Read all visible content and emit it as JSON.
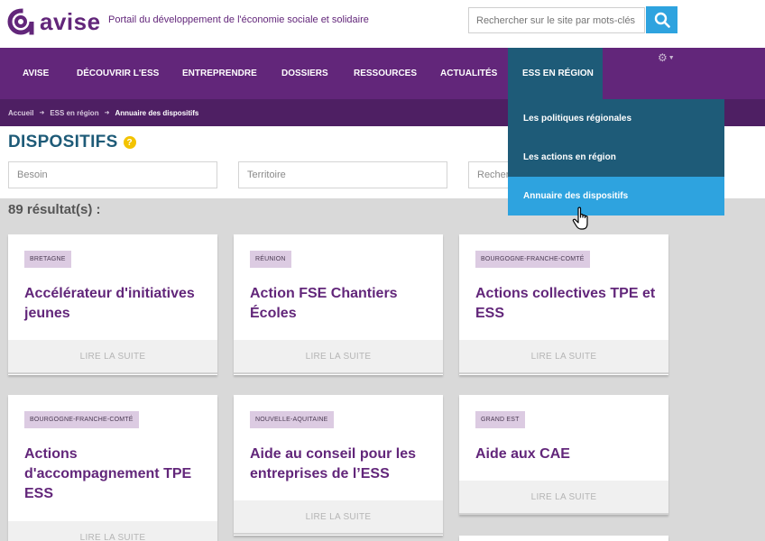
{
  "header": {
    "logo_text": "avise",
    "tagline": "Portail du développement de l'économie sociale et solidaire",
    "search": {
      "placeholder": "Rechercher sur le site par mots-clés"
    }
  },
  "nav": {
    "items": [
      {
        "label": "AVISE"
      },
      {
        "label": "DÉCOUVRIR L'ESS"
      },
      {
        "label": "ENTREPRENDRE"
      },
      {
        "label": "DOSSIERS"
      },
      {
        "label": "RESSOURCES"
      },
      {
        "label": "ACTUALITÉS"
      },
      {
        "label": "ESS EN RÉGION"
      }
    ],
    "active_index": 6
  },
  "dropdown": {
    "items": [
      {
        "label": "Les politiques régionales"
      },
      {
        "label": "Les actions en région"
      },
      {
        "label": "Annuaire des dispositifs"
      }
    ],
    "hovered_index": 2
  },
  "breadcrumb": [
    "Accueil",
    "ESS en région",
    "Annuaire des dispositifs"
  ],
  "page": {
    "title": "DISPOSITIFS",
    "filters": {
      "besoin_placeholder": "Besoin",
      "territoire_placeholder": "Territoire",
      "recherche_placeholder": "Recherche"
    },
    "results_text": "89 résultat(s) :"
  },
  "cards": [
    {
      "region": "BRETAGNE",
      "title": "Accélérateur d'initiatives jeunes",
      "link": "LIRE LA SUITE"
    },
    {
      "region": "RÉUNION",
      "title": "Action FSE Chantiers Écoles",
      "link": "LIRE LA SUITE"
    },
    {
      "region": "BOURGOGNE-FRANCHE-COMTÉ",
      "title": "Actions collectives TPE et ESS",
      "link": "LIRE LA SUITE"
    },
    {
      "region": "BOURGOGNE-FRANCHE-COMTÉ",
      "title": "Actions d'accompagnement TPE ESS",
      "link": "LIRE LA SUITE"
    },
    {
      "region": "NOUVELLE-AQUITAINE",
      "title": "Aide au conseil pour les entreprises de l’ESS",
      "link": "LIRE LA SUITE"
    },
    {
      "region": "GRAND EST",
      "title": "Aide aux CAE",
      "link": "LIRE LA SUITE"
    }
  ],
  "colors": {
    "brand_purple": "#62267a",
    "breadcrumb_purple": "#4e1f63",
    "nav_active": "#1e5b78",
    "accent_blue": "#2ea3df",
    "help_yellow": "#f3c300"
  }
}
